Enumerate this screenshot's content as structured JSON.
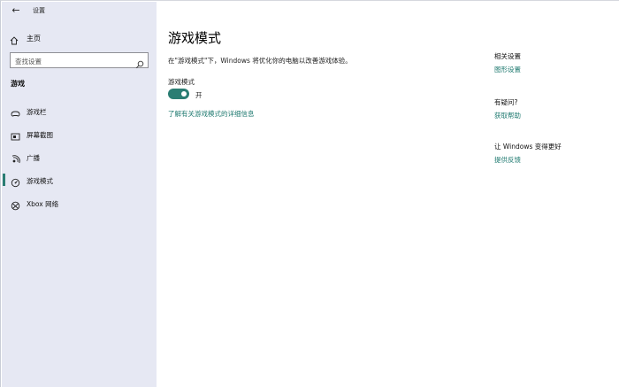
{
  "window": {
    "title": "设置",
    "back_glyph": "←"
  },
  "sidebar": {
    "home_label": "主页",
    "search_placeholder": "查找设置",
    "section_title": "游戏",
    "items": [
      {
        "label": "游戏栏",
        "icon": "game-bar-icon"
      },
      {
        "label": "屏幕截图",
        "icon": "screenshot-icon"
      },
      {
        "label": "广播",
        "icon": "broadcast-icon"
      },
      {
        "label": "游戏模式",
        "icon": "game-mode-icon",
        "active": true
      },
      {
        "label": "Xbox 网络",
        "icon": "xbox-icon"
      }
    ]
  },
  "main": {
    "title": "游戏模式",
    "description": "在\"游戏模式\"下，Windows 将优化你的电脑以改善游戏体验。",
    "toggle_label": "游戏模式",
    "toggle_state": "开",
    "learn_more": "了解有关游戏模式的详细信息"
  },
  "aside": {
    "related_heading": "相关设置",
    "related_link": "图形设置",
    "question_heading": "有疑问?",
    "question_link": "获取帮助",
    "feedback_heading": "让 Windows 变得更好",
    "feedback_link": "提供反馈"
  },
  "colors": {
    "accent": "#2a7d73",
    "sidebar_bg": "#e6e8f3"
  }
}
